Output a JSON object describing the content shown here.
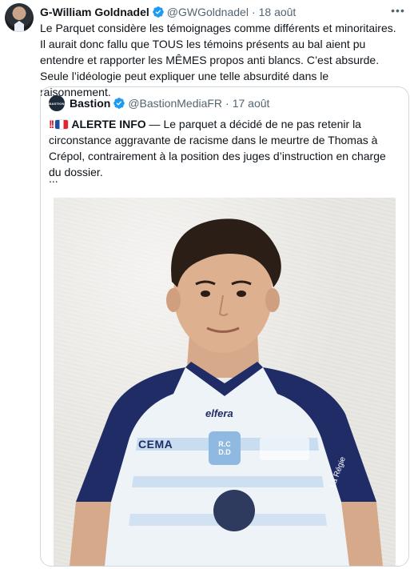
{
  "tweet": {
    "author_name": "G-William Goldnadel",
    "author_handle": "@GWGoldnadel",
    "date": "18 août",
    "more_icon": "more-horizontal-icon",
    "text": "Le Parquet considère les témoignages comme différents et minoritaires. Il aurait donc fallu que TOUS les témoins présents au bal aient pu entendre et rapporter les MÊMES propos anti blancs. C’est absurde. Seule l’idéologie peut expliquer une telle absurdité dans le raisonnement."
  },
  "quote": {
    "author_name": "Bastion",
    "author_handle": "@BastionMediaFR",
    "date": "17 août",
    "avatar_text": "BASTION",
    "alert_label": "ALERTE INFO",
    "text": " — Le parquet a décidé de ne pas retenir la circonstance aggravante de racisme dans le meurtre de Thomas à Crépol, contrairement à la position des juges d’instruction en charge du dossier.",
    "ellipsis": "...",
    "photo": {
      "jersey_sponsor_1": "CEMA",
      "jersey_sponsor_2": "elfera",
      "jersey_badge": "R.C D.D",
      "jersey_right_text": "La Régie"
    }
  },
  "colors": {
    "verified_blue": "#1d9bf0",
    "muted_text": "#536471",
    "border": "#cfd9de"
  }
}
